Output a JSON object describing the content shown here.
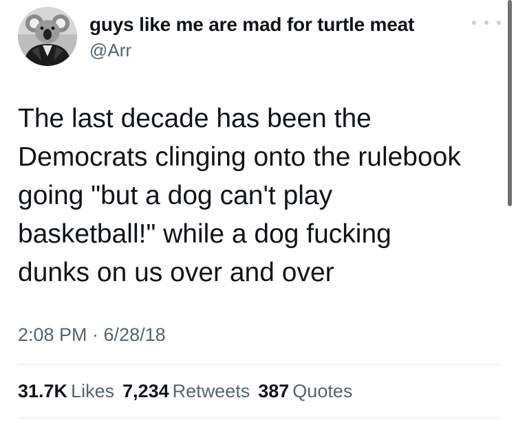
{
  "author": {
    "display_name": "guys like me are mad for turtle meat",
    "handle": "@Arr",
    "avatar_icon": "koala-avatar-icon"
  },
  "more_icon": "more-options-icon",
  "tweet": {
    "lines": [
      "The last decade has been the",
      "Democrats clinging onto the rulebook",
      "going \"but a dog can't play",
      "basketball!\" while a dog fucking",
      "dunks on us over and over"
    ],
    "timestamp": "2:08 PM · 6/28/18"
  },
  "stats": {
    "likes_count": "31.7K",
    "likes_label": "Likes",
    "retweets_count": "7,234",
    "retweets_label": "Retweets",
    "quotes_count": "387",
    "quotes_label": "Quotes"
  },
  "colors": {
    "text": "#0f1419",
    "secondary": "#536471",
    "divider": "#e4e7e9"
  }
}
